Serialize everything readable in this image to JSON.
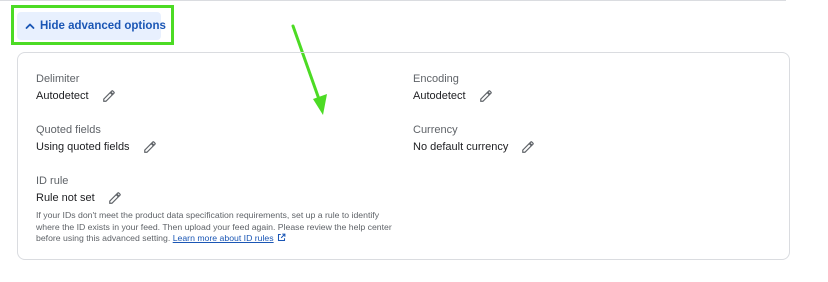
{
  "toggle": {
    "label": "Hide advanced options"
  },
  "fields": {
    "delimiter": {
      "label": "Delimiter",
      "value": "Autodetect"
    },
    "encoding": {
      "label": "Encoding",
      "value": "Autodetect"
    },
    "quoted_fields": {
      "label": "Quoted fields",
      "value": "Using quoted fields"
    },
    "currency": {
      "label": "Currency",
      "value": "No default currency"
    },
    "id_rule": {
      "label": "ID rule",
      "value": "Rule not set",
      "help": "If your IDs don't meet the product data specification requirements, set up a rule to identify where the ID exists in your feed. Then upload your feed again. Please review the help center before using this advanced setting.",
      "link": "Learn more about ID rules"
    }
  },
  "icons": {
    "toggle": "chevron-up-icon",
    "edit": "pencil-icon",
    "external": "open-in-new-icon"
  },
  "colors": {
    "accent": "#1a56b5",
    "toggle_bg": "#e8f0fe",
    "annotation": "#4cdb24"
  }
}
